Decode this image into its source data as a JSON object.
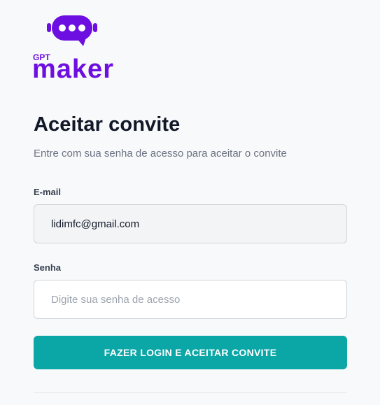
{
  "brand": {
    "logo_small_text": "GPT",
    "logo_large_text": "maker",
    "logo_color": "#6d0fe0",
    "icon": "robot-chat-bubble-icon"
  },
  "page": {
    "title": "Aceitar convite",
    "subtitle": "Entre com sua senha de acesso para aceitar o convite"
  },
  "form": {
    "email_label": "E-mail",
    "email_value": "lidimfc@gmail.com",
    "password_label": "Senha",
    "password_placeholder": "Digite sua senha de acesso",
    "submit_label": "FAZER LOGIN E ACEITAR CONVITE",
    "submit_color": "#0ba6a6"
  }
}
